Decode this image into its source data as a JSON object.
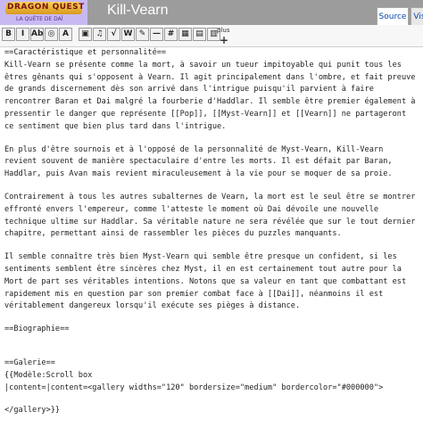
{
  "header": {
    "logo_text": "DRAGON QUEST",
    "logo_subtitle": "LA QUÊTE DE DAÏ",
    "page_title": "Kill-Vearn",
    "tabs": [
      {
        "label": "Source"
      },
      {
        "label": "Vis"
      }
    ]
  },
  "toolbar": {
    "buttons": [
      {
        "name": "bold-icon",
        "glyph": "B"
      },
      {
        "name": "italic-icon",
        "glyph": "I"
      },
      {
        "name": "link-icon",
        "glyph": "Ab"
      },
      {
        "name": "external-link-icon",
        "glyph": "◎"
      },
      {
        "name": "heading-icon",
        "glyph": "A"
      },
      {
        "name": "image-icon",
        "glyph": "▣"
      },
      {
        "name": "media-icon",
        "glyph": "♫"
      },
      {
        "name": "math-icon",
        "glyph": "√"
      },
      {
        "name": "nowiki-icon",
        "glyph": "W"
      },
      {
        "name": "signature-icon",
        "glyph": "✎"
      },
      {
        "name": "horizontal-line-icon",
        "glyph": "—"
      },
      {
        "name": "redirect-icon",
        "glyph": "#"
      },
      {
        "name": "table-icon",
        "glyph": "▦"
      },
      {
        "name": "gallery-icon",
        "glyph": "▤"
      },
      {
        "name": "template-icon",
        "glyph": "▥"
      }
    ],
    "plus_label": "plus",
    "plus_glyph": "+"
  },
  "editor": {
    "lines": [
      "==Caractéristique et personnalité==",
      "Kill-Vearn se présente comme la mort, à savoir un tueur impitoyable qui punit tous les êtres gênants qui s'opposent à Vearn. Il agit principalement dans l'ombre, et fait preuve de grands discernement dès son arrivé dans l'intrigue puisqu'il parvient à faire rencontrer Baran et Dai malgré la fourberie d'Haddlar. Il semble être premier également à pressentir le danger que représente [[Pop]], [[Myst-Vearn]] et [[Vearn]] ne partageront ce sentiment que bien plus tard dans l'intrigue.",
      "En plus d'être sournois et à l'opposé de la personnalité de Myst-Vearn, Kill-Vearn revient souvent de manière spectaculaire d'entre les morts. Il est défait par Baran, Haddlar, puis Avan mais revient miraculeusement à la vie pour se moquer de sa proie.",
      "Contrairement à tous les autres subalternes de Vearn, la mort est le seul être se montrer effronté envers l'empereur, comme l'atteste le moment où Dai dévoile une nouvelle technique ultime sur Haddlar. Sa véritable nature ne sera révélée que sur le tout dernier chapitre, permettant ainsi de rassembler les pièces du puzzles manquants.",
      "Il semble connaître très bien Myst-Vearn qui semble être presque un confident, si les sentiments semblent être sincères chez Myst, il en est certainement tout autre pour la Mort de part ses véritables intentions. Notons que sa valeur en tant que combattant est rapidement mis en question par son premier combat face à [[Dai]], néanmoins il est véritablement dangereux lorsqu'il exécute ses pièges à distance.",
      "==Biographie==",
      "==Galerie==",
      "{{Modèle:Scroll box",
      "|content=|content=<gallery widths=\"120\" bordersize=\"medium\" bordercolor=\"#000000\">",
      "</gallery>}}"
    ]
  }
}
